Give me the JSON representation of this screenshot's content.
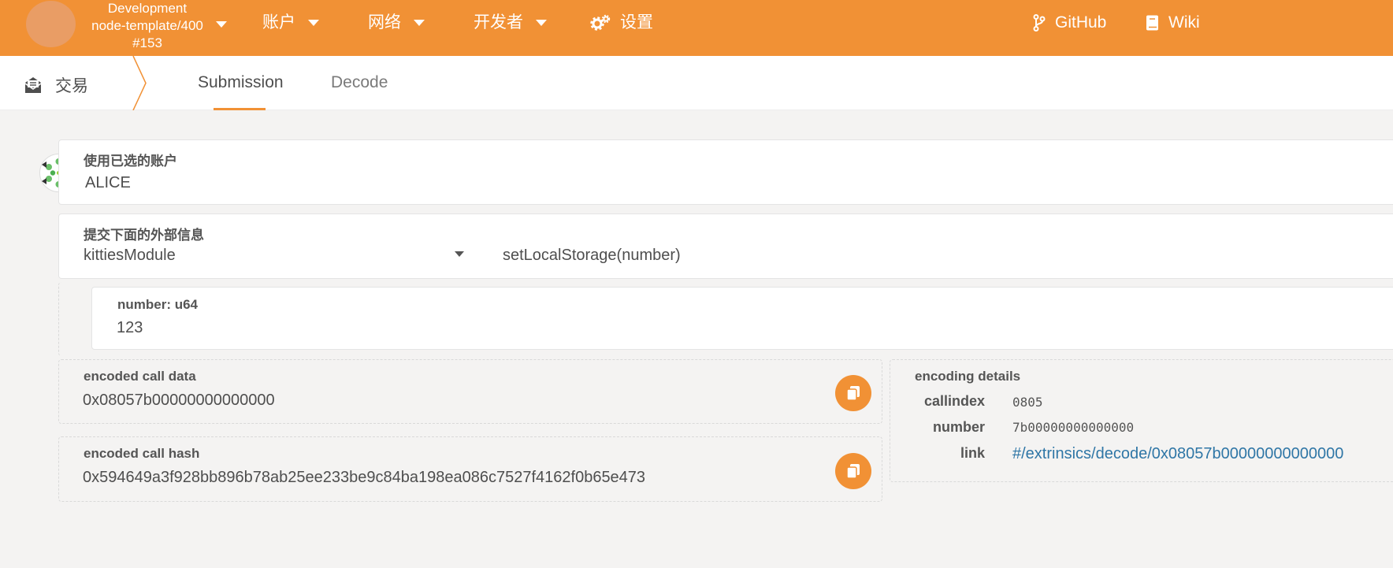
{
  "topbar": {
    "chain": {
      "line1": "Development",
      "line2": "node-template/400",
      "line3": "#153"
    },
    "menu": [
      {
        "label": "账户"
      },
      {
        "label": "网络"
      },
      {
        "label": "开发者"
      }
    ],
    "settings_label": "设置",
    "github_label": "GitHub",
    "wiki_label": "Wiki"
  },
  "tabbar": {
    "section_title": "交易",
    "tabs": [
      {
        "label": "Submission",
        "active": true
      },
      {
        "label": "Decode",
        "active": false
      }
    ]
  },
  "account": {
    "label": "使用已选的账户",
    "value": "ALICE"
  },
  "extrinsic": {
    "label": "提交下面的外部信息",
    "module": "kittiesModule",
    "call": "setLocalStorage(number)"
  },
  "param": {
    "label": "number: u64",
    "value": "123"
  },
  "encoded_call_data": {
    "label": "encoded call data",
    "value": "0x08057b00000000000000"
  },
  "encoded_call_hash": {
    "label": "encoded call hash",
    "value": "0x594649a3f928bb896b78ab25ee233be9c84ba198ea086c7527f4162f0b65e473"
  },
  "encoding_details": {
    "title": "encoding details",
    "callindex_key": "callindex",
    "callindex_value": "0805",
    "number_key": "number",
    "number_value": "7b00000000000000",
    "link_key": "link",
    "link_value": "#/extrinsics/decode/0x08057b00000000000000"
  },
  "colors": {
    "accent": "#f19135",
    "link": "#2f76a6"
  }
}
